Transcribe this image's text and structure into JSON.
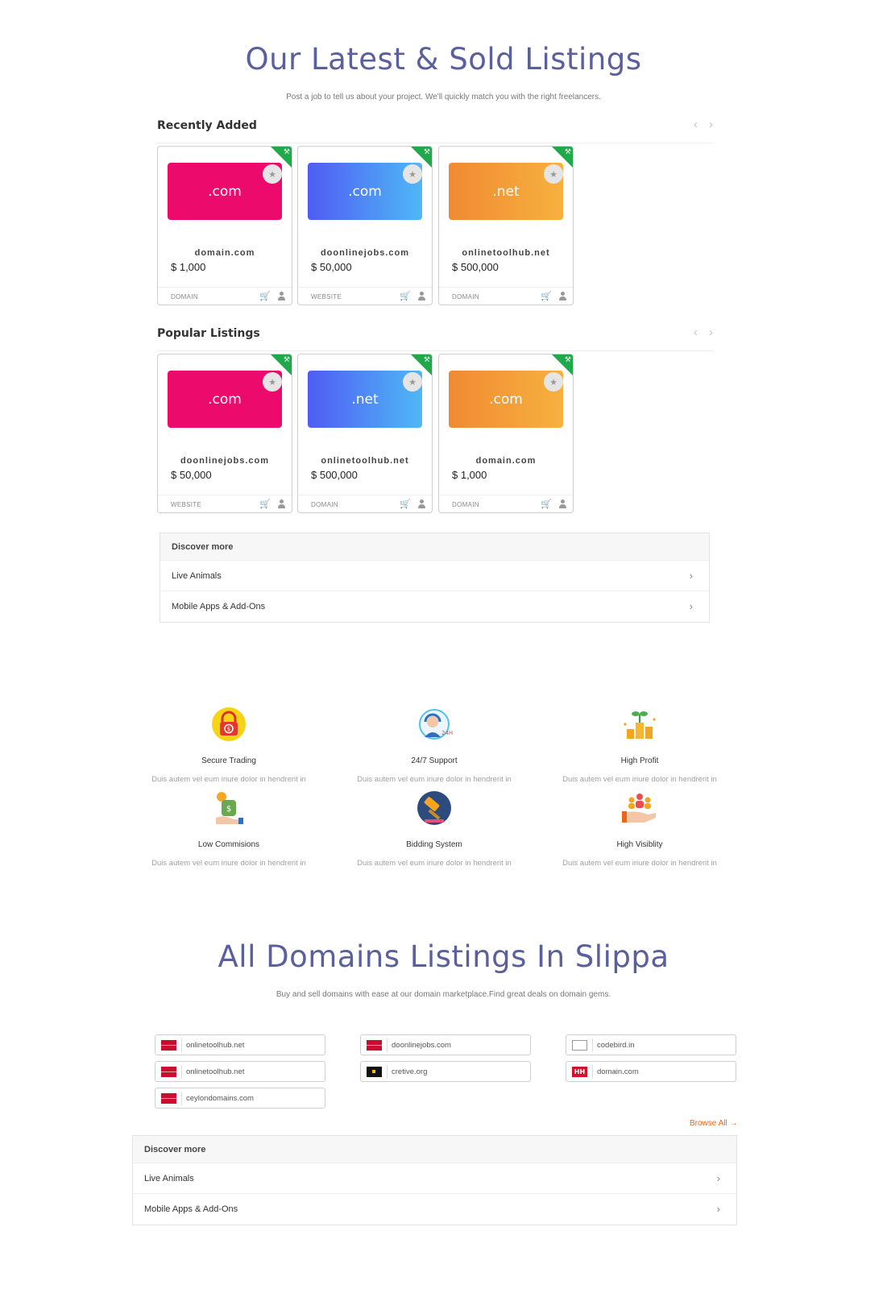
{
  "hero": {
    "title": "Our Latest & Sold Listings",
    "subtitle": "Post a job to tell us about your project. We'll quickly match you with the right freelancers."
  },
  "recent": {
    "title": "Recently Added",
    "prev": "‹",
    "next": "›",
    "cards": [
      {
        "ext": ".com",
        "domain": "domain.com",
        "price": "$ 1,000",
        "type": "DOMAIN"
      },
      {
        "ext": ".com",
        "domain": "doonlinejobs.com",
        "price": "$ 50,000",
        "type": "WEBSITE"
      },
      {
        "ext": ".net",
        "domain": "onlinetoolhub.net",
        "price": "$ 500,000",
        "type": "DOMAIN"
      }
    ]
  },
  "popular": {
    "title": "Popular Listings",
    "prev": "‹",
    "next": "›",
    "cards": [
      {
        "ext": ".com",
        "domain": "doonlinejobs.com",
        "price": "$ 50,000",
        "type": "WEBSITE"
      },
      {
        "ext": ".net",
        "domain": "onlinetoolhub.net",
        "price": "$ 500,000",
        "type": "DOMAIN"
      },
      {
        "ext": ".com",
        "domain": "domain.com",
        "price": "$ 1,000",
        "type": "DOMAIN"
      }
    ]
  },
  "discover1": {
    "title": "Discover more",
    "items": [
      "Live Animals",
      "Mobile Apps & Add-Ons"
    ]
  },
  "features": [
    {
      "title": "Secure Trading",
      "desc": "Duis autem vel eum iriure dolor in hendrerit in",
      "icon": "lock-icon"
    },
    {
      "title": "24/7 Support",
      "desc": "Duis autem vel eum iriure dolor in hendrerit in",
      "icon": "support-agent-icon"
    },
    {
      "title": "High Profit",
      "desc": "Duis autem vel eum iriure dolor in hendrerit in",
      "icon": "coins-plant-icon"
    },
    {
      "title": "Low Commisions",
      "desc": "Duis autem vel eum iriure dolor in hendrerit in",
      "icon": "money-hand-icon"
    },
    {
      "title": "Bidding System",
      "desc": "Duis autem vel eum iriure dolor in hendrerit in",
      "icon": "gavel-icon"
    },
    {
      "title": "High Visiblity",
      "desc": "Duis autem vel eum iriure dolor in hendrerit in",
      "icon": "people-hand-icon"
    }
  ],
  "all": {
    "title": "All Domains Listings In Slippa",
    "subtitle": "Buy and sell domains with ease at our domain marketplace.Find great deals on domain gems."
  },
  "domains": [
    {
      "name": "onlinetoolhub.net",
      "flag": "red"
    },
    {
      "name": "onlinetoolhub.net",
      "flag": "red"
    },
    {
      "name": "ceylondomains.com",
      "flag": "red"
    },
    {
      "name": "doonlinejobs.com",
      "flag": "red"
    },
    {
      "name": "cretive.org",
      "flag": "dark"
    },
    {
      "name": "codebird.in",
      "flag": "white"
    },
    {
      "name": "domain.com",
      "flag": "hh",
      "flag_text": "HH"
    }
  ],
  "browse": "Browse All →",
  "discover2": {
    "title": "Discover more",
    "items": [
      "Live Animals",
      "Mobile Apps & Add-Ons"
    ]
  },
  "colors": {
    "accent": "#5a5f9e",
    "ribbon": "#1fa94b",
    "cart": "#2e7cd7",
    "browse": "#e8651a"
  },
  "icons": {
    "star": "★",
    "cart": "🛒",
    "chevron": "›",
    "ribbon": "⚒"
  }
}
